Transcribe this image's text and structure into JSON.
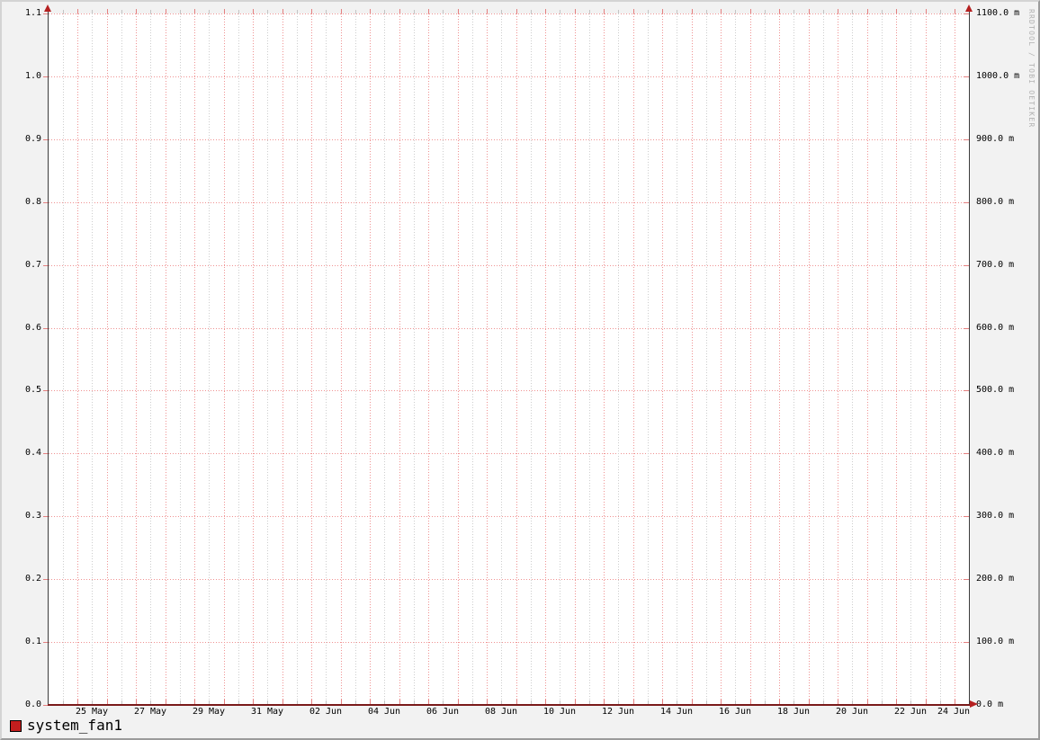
{
  "watermark": "RRDTOOL / TOBI OETIKER",
  "legend": {
    "label": "system_fan1",
    "color": "#c41e1e"
  },
  "axes": {
    "left_labels": [
      "0.0",
      "0.1",
      "0.2",
      "0.3",
      "0.4",
      "0.5",
      "0.6",
      "0.7",
      "0.8",
      "0.9",
      "1.0",
      "1.1"
    ],
    "right_labels": [
      "0.0 m",
      "100.0 m",
      "200.0 m",
      "300.0 m",
      "400.0 m",
      "500.0 m",
      "600.0 m",
      "700.0 m",
      "800.0 m",
      "900.0 m",
      "1000.0 m",
      "1100.0 m"
    ],
    "x_labels": [
      "25 May",
      "27 May",
      "29 May",
      "31 May",
      "02 Jun",
      "04 Jun",
      "06 Jun",
      "08 Jun",
      "10 Jun",
      "12 Jun",
      "14 Jun",
      "16 Jun",
      "18 Jun",
      "20 Jun",
      "22 Jun",
      "24 Jun"
    ]
  },
  "colors": {
    "background": "#f2f2f2",
    "canvas": "#ffffff",
    "grid_minor": "#cdcdcd",
    "grid_major": "#ef9292",
    "tick_major": "#e57f7f",
    "tick_minor": "#c4c4c4",
    "axis_line": "#3c3c3c",
    "x_axis_line": "#7a1a1a",
    "arrow": "#b52020",
    "shade_top_left": "#d4d4d4",
    "shade_bottom_right": "#9b9b9b",
    "watermark": "#b2b2b2"
  },
  "chart_data": {
    "type": "line",
    "title": "",
    "xlabel": "",
    "ylabel": "",
    "categories": [
      "25 May",
      "27 May",
      "29 May",
      "31 May",
      "02 Jun",
      "04 Jun",
      "06 Jun",
      "08 Jun",
      "10 Jun",
      "12 Jun",
      "14 Jun",
      "16 Jun",
      "18 Jun",
      "20 Jun",
      "22 Jun",
      "24 Jun"
    ],
    "series": [
      {
        "name": "system_fan1",
        "color": "#c41e1e",
        "values": [
          0,
          0,
          0,
          0,
          0,
          0,
          0,
          0,
          0,
          0,
          0,
          0,
          0,
          0,
          0,
          0
        ]
      }
    ],
    "ylim_left": [
      0.0,
      1.1
    ],
    "y_tick_step_left": 0.1,
    "ylim_right": [
      0.0,
      1100.0
    ],
    "y_tick_step_right": 100.0,
    "right_axis_unit": "m",
    "x_minor_grid_interval": "12 hours",
    "x_major_grid_interval": "1 day",
    "grid": true,
    "legend_position": "bottom-left",
    "note": "Series is flat at 0 for the entire time range; red series line overlaps the x-axis baseline."
  }
}
